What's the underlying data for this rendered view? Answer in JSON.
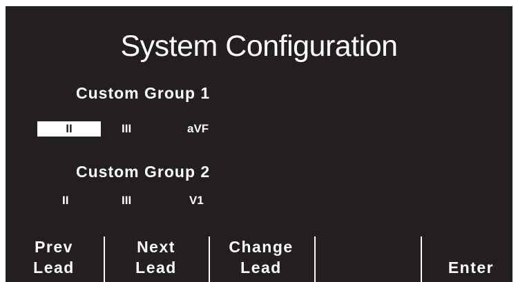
{
  "screen": {
    "title": "System Configuration"
  },
  "groups": [
    {
      "title": "Custom Group 1",
      "leads": [
        "II",
        "III",
        "aVF"
      ],
      "selected_index": 0
    },
    {
      "title": "Custom Group 2",
      "leads": [
        "II",
        "III",
        "V1"
      ]
    }
  ],
  "softkeys": [
    {
      "line1": "Prev",
      "line2": "Lead"
    },
    {
      "line1": "Next",
      "line2": "Lead"
    },
    {
      "line1": "Change",
      "line2": "Lead"
    },
    {
      "line1": "",
      "line2": ""
    },
    {
      "line1": "",
      "line2": "Enter"
    }
  ],
  "colors": {
    "background": "#231f20",
    "foreground": "#ffffff",
    "highlight": "#ffffff"
  }
}
